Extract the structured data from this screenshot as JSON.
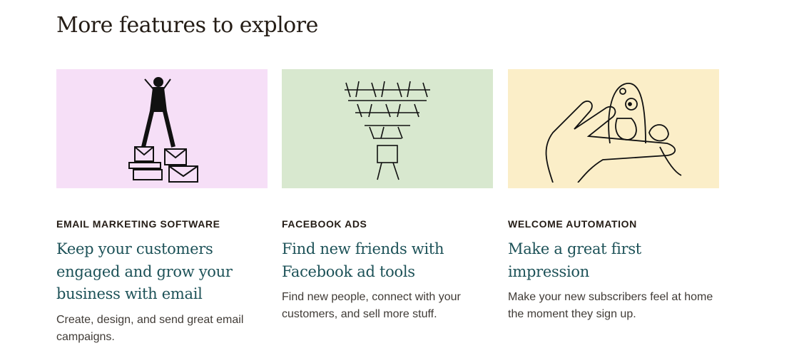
{
  "section_title": "More features to explore",
  "colors": {
    "pink": "#f6dff7",
    "green": "#d8e8cf",
    "yellow": "#fbeec8",
    "heading": "#1d5258"
  },
  "cards": [
    {
      "eyebrow": "EMAIL MARKETING SOFTWARE",
      "heading": "Keep your customers engaged and grow your business with email",
      "body": "Create, design, and send great email campaigns.",
      "illustration": "person-standing-on-envelopes"
    },
    {
      "eyebrow": "FACEBOOK ADS",
      "heading": "Find new friends with Facebook ad tools",
      "body": "Find new people, connect with your customers, and sell more stuff.",
      "illustration": "crowd-funnel"
    },
    {
      "eyebrow": "WELCOME AUTOMATION",
      "heading": "Make a great first impression",
      "body": "Make your new subscribers feel at home the moment they sign up.",
      "illustration": "hand-holding-creatures"
    }
  ]
}
